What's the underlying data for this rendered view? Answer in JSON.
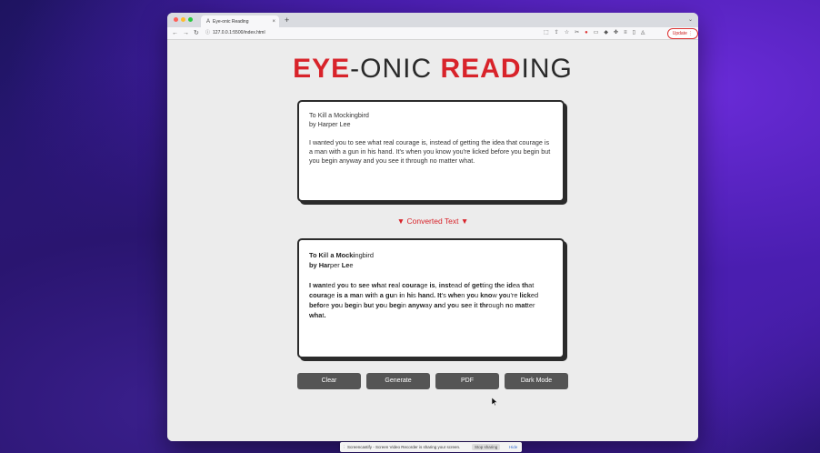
{
  "browser": {
    "tab_title": "Eye-onic Reading",
    "tab_icon": "A",
    "tab_close": "×",
    "new_tab": "+",
    "tab_menu": "⌄",
    "url": "127.0.0.1:5500/index.html",
    "update_label": "Update",
    "traffic_colors": [
      "#ff5f57",
      "#febc2e",
      "#28c840"
    ]
  },
  "app": {
    "title_part1_bold": "EYE",
    "title_part1_rest": "-ONIC ",
    "title_part2_bold": "READ",
    "title_part2_rest": "ING",
    "accent_color": "#d8232a"
  },
  "input": {
    "title": "To Kill a Mockingbird",
    "author": "by Harper Lee",
    "body": "I wanted you to see what real courage is, instead of getting the idea that courage is a man with a gun in his hand. It's when you know you're licked before you begin but you begin anyway and you see it through no matter what."
  },
  "converted_label": "▼ Converted Text ▼",
  "output": {
    "lines": [
      [
        [
          "To",
          ""
        ],
        [
          " ",
          ""
        ],
        [
          "Ki",
          "ll"
        ],
        [
          " ",
          ""
        ],
        [
          "a",
          ""
        ],
        [
          " ",
          ""
        ],
        [
          "Mocki",
          "ngbird"
        ]
      ],
      [
        [
          "by",
          ""
        ],
        [
          " ",
          ""
        ],
        [
          "Har",
          "per"
        ],
        [
          " ",
          ""
        ],
        [
          "Le",
          "e"
        ]
      ],
      [],
      [
        [
          "I",
          ""
        ],
        [
          " ",
          ""
        ],
        [
          "wan",
          "ted"
        ],
        [
          " ",
          ""
        ],
        [
          "yo",
          "u"
        ],
        [
          " ",
          ""
        ],
        [
          "t",
          "o"
        ],
        [
          " ",
          ""
        ],
        [
          "se",
          "e"
        ],
        [
          " ",
          ""
        ],
        [
          "wh",
          "at"
        ],
        [
          " ",
          ""
        ],
        [
          "re",
          "al"
        ],
        [
          " ",
          ""
        ],
        [
          "coura",
          "ge"
        ],
        [
          " ",
          ""
        ],
        [
          "is",
          ","
        ],
        [
          " ",
          ""
        ],
        [
          "inst",
          "ead"
        ],
        [
          " ",
          ""
        ],
        [
          "o",
          "f"
        ],
        [
          " ",
          ""
        ],
        [
          "get",
          "ting"
        ],
        [
          " ",
          ""
        ],
        [
          "th",
          "e"
        ],
        [
          " ",
          ""
        ],
        [
          "id",
          "ea"
        ],
        [
          " ",
          ""
        ],
        [
          "th",
          "at"
        ]
      ],
      [
        [
          "coura",
          "ge"
        ],
        [
          " ",
          ""
        ],
        [
          "is",
          ""
        ],
        [
          " ",
          ""
        ],
        [
          "a",
          ""
        ],
        [
          " ",
          ""
        ],
        [
          "ma",
          "n"
        ],
        [
          " ",
          ""
        ],
        [
          "wi",
          "th"
        ],
        [
          " ",
          ""
        ],
        [
          "a",
          ""
        ],
        [
          " ",
          ""
        ],
        [
          "gu",
          "n"
        ],
        [
          " ",
          ""
        ],
        [
          "i",
          "n"
        ],
        [
          " ",
          ""
        ],
        [
          "hi",
          "s"
        ],
        [
          " ",
          ""
        ],
        [
          "han",
          "d"
        ],
        [
          ". ",
          ""
        ],
        [
          "It",
          "'s"
        ],
        [
          " ",
          ""
        ],
        [
          "whe",
          "n"
        ],
        [
          " ",
          ""
        ],
        [
          "yo",
          "u"
        ],
        [
          " ",
          ""
        ],
        [
          "kno",
          "w"
        ],
        [
          " ",
          ""
        ],
        [
          "yo",
          "u're"
        ],
        [
          " ",
          ""
        ],
        [
          "lick",
          "ed"
        ]
      ],
      [
        [
          "befo",
          "re"
        ],
        [
          " ",
          ""
        ],
        [
          "yo",
          "u"
        ],
        [
          " ",
          ""
        ],
        [
          "beg",
          "in"
        ],
        [
          " ",
          ""
        ],
        [
          "bu",
          "t"
        ],
        [
          " ",
          ""
        ],
        [
          "yo",
          "u"
        ],
        [
          " ",
          ""
        ],
        [
          "beg",
          "in"
        ],
        [
          " ",
          ""
        ],
        [
          "anyw",
          "ay"
        ],
        [
          " ",
          ""
        ],
        [
          "an",
          "d"
        ],
        [
          " ",
          ""
        ],
        [
          "yo",
          "u"
        ],
        [
          " ",
          ""
        ],
        [
          "se",
          "e"
        ],
        [
          " ",
          ""
        ],
        [
          "i",
          "t"
        ],
        [
          " ",
          ""
        ],
        [
          "thr",
          "ough"
        ],
        [
          " ",
          ""
        ],
        [
          "n",
          "o"
        ],
        [
          " ",
          ""
        ],
        [
          "mat",
          "ter"
        ],
        [
          " ",
          ""
        ],
        [
          "wha",
          "t"
        ],
        [
          ".",
          ""
        ]
      ]
    ]
  },
  "buttons": {
    "clear": "Clear",
    "generate": "Generate",
    "pdf": "PDF",
    "dark_mode": "Dark Mode",
    "color": "#555555"
  },
  "share_bar": {
    "message": "Screencastify - Screen Video Recorder is sharing your screen.",
    "stop": "Stop sharing",
    "hide": "Hide"
  }
}
